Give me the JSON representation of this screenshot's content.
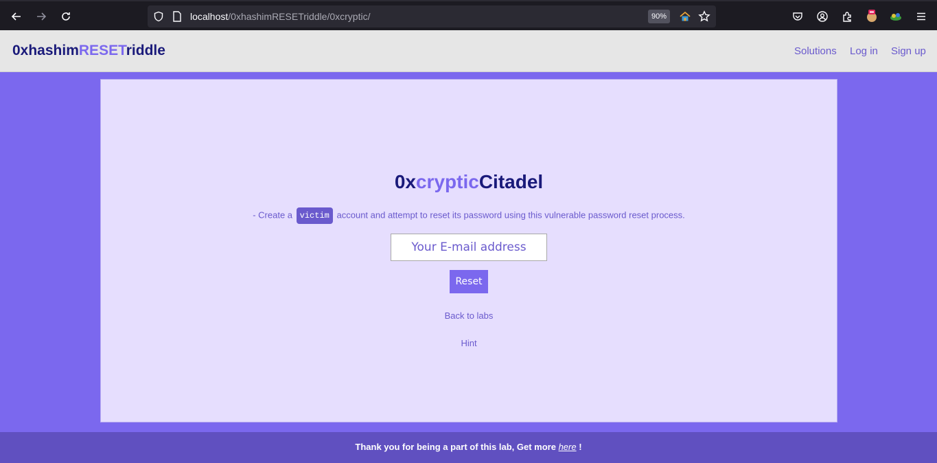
{
  "browser": {
    "url_host": "localhost",
    "url_path": "/0xhashimRESETriddle/0xcryptic/",
    "zoom": "90%"
  },
  "header": {
    "brand_part1": "0xhashim",
    "brand_part2": "RESET",
    "brand_part3": "riddle",
    "nav": [
      "Solutions",
      "Log in",
      "Sign up"
    ]
  },
  "main": {
    "title_part1": "0x",
    "title_part2": "cryptic",
    "title_part3": "Citadel",
    "desc_before": "- Create a",
    "desc_badge": "victim",
    "desc_after": "account and attempt to reset its password using this vulnerable password reset process.",
    "email_placeholder": "Your E-mail address",
    "reset_label": "Reset",
    "back_link": "Back to labs",
    "hint_link": "Hint"
  },
  "footer": {
    "text_before": "Thank you for being a part of this lab, Get more",
    "link": "here",
    "text_after": "!"
  },
  "colors": {
    "accent": "#7b68ee",
    "brand_dark": "#1a1a7a",
    "card_bg": "#e6defe",
    "footer_bg": "#6050c0"
  }
}
